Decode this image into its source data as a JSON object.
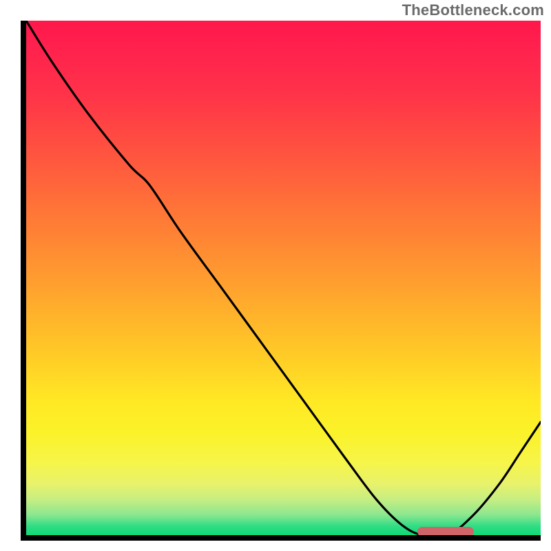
{
  "watermark": "TheBottleneck.com",
  "chart_data": {
    "type": "line",
    "title": "",
    "xlabel": "",
    "ylabel": "",
    "xlim": [
      0,
      100
    ],
    "ylim": [
      0,
      100
    ],
    "grid": false,
    "legend": false,
    "series": [
      {
        "name": "curve",
        "color": "#000000",
        "x": [
          0,
          5,
          12,
          20,
          24,
          30,
          38,
          46,
          54,
          62,
          68,
          73,
          77,
          82,
          87,
          92,
          96,
          100
        ],
        "y": [
          100,
          92,
          82,
          72,
          68,
          59,
          48,
          37,
          26,
          15,
          7,
          2,
          0,
          0,
          4,
          10,
          16,
          22
        ]
      }
    ],
    "marker_bar": {
      "x_start": 76,
      "x_end": 87,
      "y": 0,
      "color": "#cf6569"
    }
  }
}
